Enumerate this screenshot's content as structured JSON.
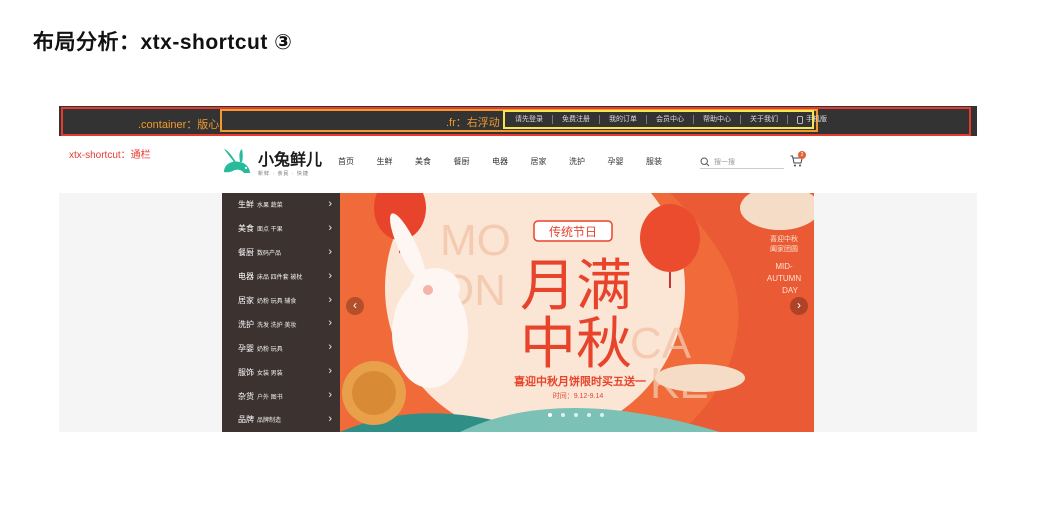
{
  "slide": {
    "title": "布局分析：xtx-shortcut ③"
  },
  "annotations": {
    "container": ".container：版心",
    "fr": ".fr：右浮动",
    "shortcut": "xtx-shortcut：通栏"
  },
  "shortcut_links": [
    "请先登录",
    "免费注册",
    "我的订单",
    "会员中心",
    "帮助中心",
    "关于我们",
    "手机版"
  ],
  "logo": {
    "name": "小兔鲜儿",
    "slogan": "新鲜 · 亲民 · 快捷"
  },
  "nav": [
    "首页",
    "生鲜",
    "美食",
    "餐厨",
    "电器",
    "居家",
    "洗护",
    "孕婴",
    "服装"
  ],
  "search": {
    "placeholder": "搜一搜"
  },
  "cart": {
    "count": "2"
  },
  "categories": [
    {
      "name": "生鲜",
      "subs": "水果 蔬菜"
    },
    {
      "name": "美食",
      "subs": "面点 干果"
    },
    {
      "name": "餐厨",
      "subs": "数码产品"
    },
    {
      "name": "电器",
      "subs": "床品 四件套 被枕"
    },
    {
      "name": "居家",
      "subs": "奶粉 玩具 辅食"
    },
    {
      "name": "洗护",
      "subs": "洗发 洗护 美妆"
    },
    {
      "name": "孕婴",
      "subs": "奶粉 玩具"
    },
    {
      "name": "服饰",
      "subs": "女装 男装"
    },
    {
      "name": "杂货",
      "subs": "户外 图书"
    },
    {
      "name": "品牌",
      "subs": "品牌制造"
    }
  ],
  "banner": {
    "festival_tag": "传统节日",
    "title_line1": "月满",
    "title_line2": "中秋",
    "promo": "喜迎中秋月饼限时买五送一",
    "date": "时间：9.12-9.14",
    "side_cn1": "喜迎中秋",
    "side_cn2": "阖家团圆",
    "side_en1": "MID-",
    "side_en2": "AUTUMN",
    "side_en3": "DAY",
    "bg_text1": "MO",
    "bg_text2": "ON",
    "bg_text3": "CA",
    "bg_text4": "KE"
  },
  "colors": {
    "bar": "#333333",
    "red_outline": "#e53b2f",
    "orange_outline": "#f29a2e",
    "yellow_outline": "#f7e64a",
    "brand_green": "#27ba9b",
    "banner_orange": "#f06a3a"
  }
}
